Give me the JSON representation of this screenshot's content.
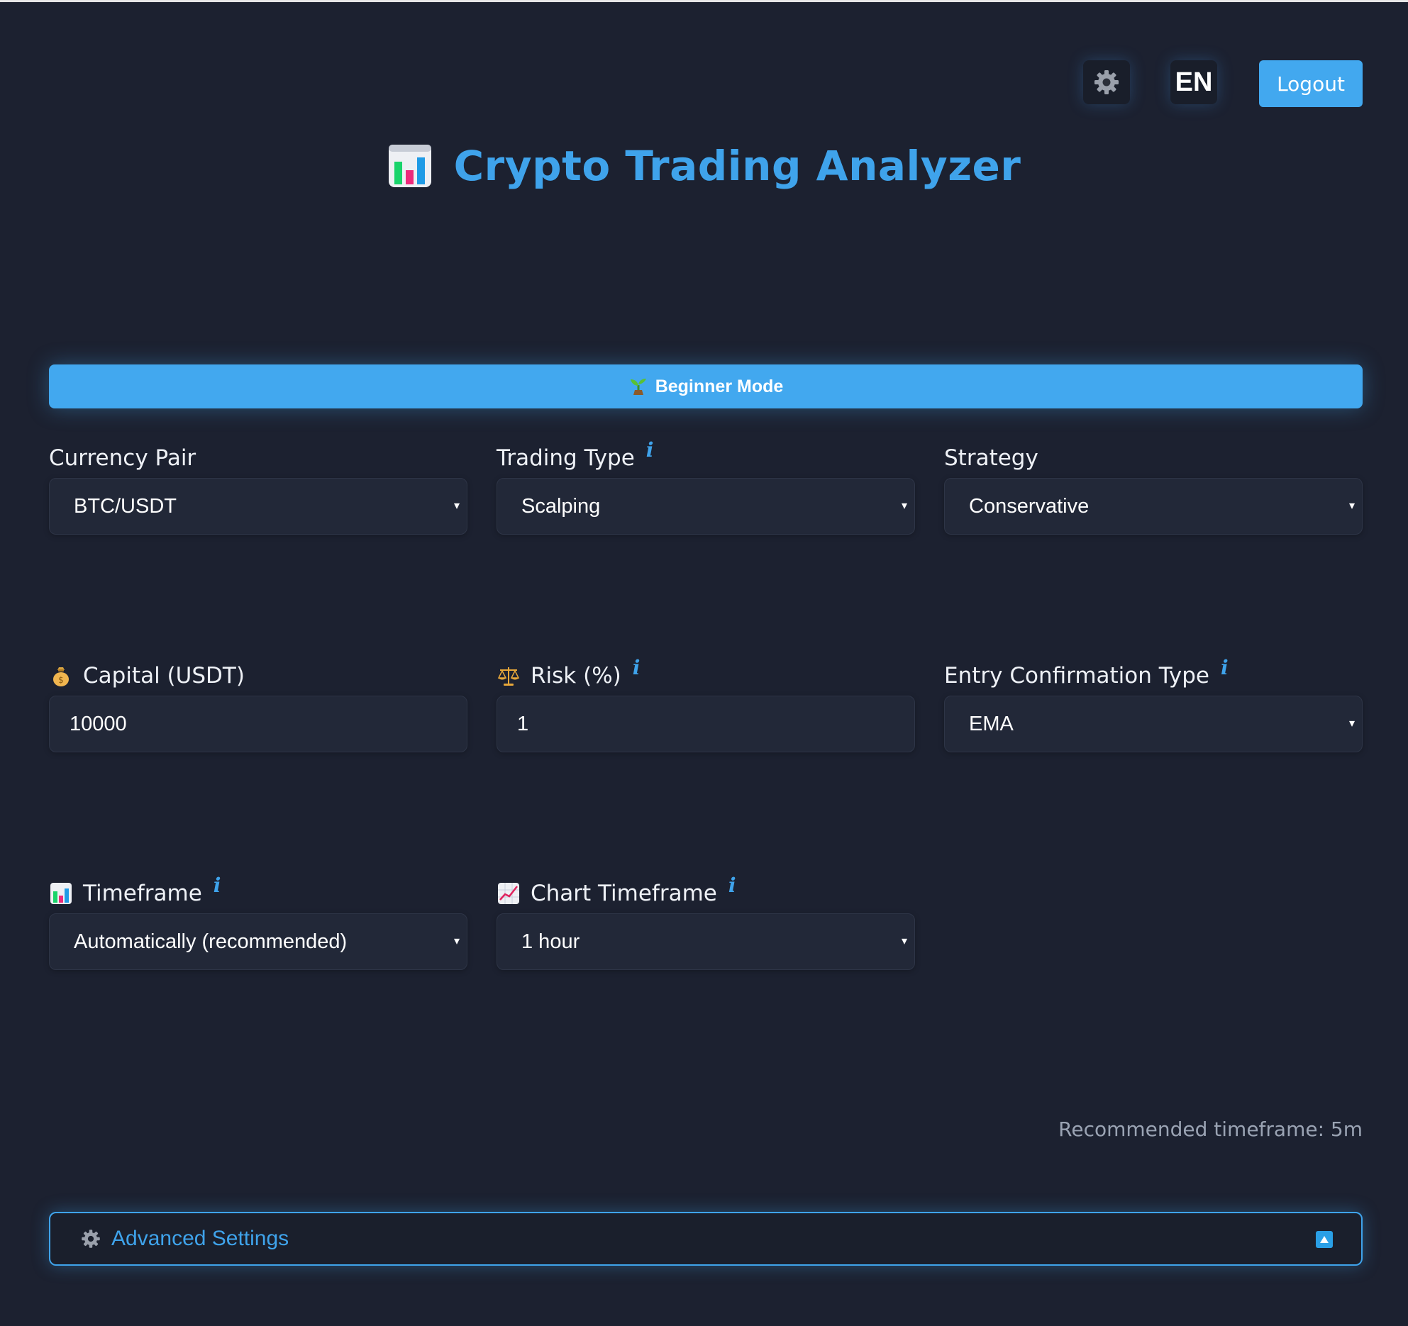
{
  "header": {
    "settings_icon": "gear-icon",
    "language": "EN",
    "logout_label": "Logout"
  },
  "title": {
    "icon": "bar-chart-icon",
    "text": "Crypto Trading Analyzer"
  },
  "mode": {
    "icon": "sprout-icon",
    "label": "Beginner Mode"
  },
  "fields": {
    "currency_pair": {
      "label": "Currency Pair",
      "value": "BTC/USDT"
    },
    "trading_type": {
      "label": "Trading Type",
      "info": "i",
      "value": "Scalping"
    },
    "strategy": {
      "label": "Strategy",
      "value": "Conservative"
    },
    "capital": {
      "icon": "money-bag-icon",
      "label": "Capital (USDT)",
      "value": "10000"
    },
    "risk": {
      "icon": "balance-scale-icon",
      "label": "Risk (%)",
      "info": "i",
      "value": "1"
    },
    "entry_confirmation": {
      "label": "Entry Confirmation Type",
      "info": "i",
      "value": "EMA"
    },
    "timeframe": {
      "icon": "bar-chart-icon",
      "label": "Timeframe",
      "info": "i",
      "value": "Automatically (recommended)"
    },
    "chart_timeframe": {
      "icon": "line-chart-icon",
      "label": "Chart Timeframe",
      "info": "i",
      "value": "1 hour"
    }
  },
  "caret": "▾",
  "recommended": "Recommended timeframe: 5m",
  "advanced": {
    "icon": "gear-icon",
    "label": "Advanced Settings",
    "toggle_icon": "collapse-up-icon"
  },
  "colors": {
    "background": "#1c2130",
    "accent": "#42a8ef",
    "title": "#3fa3eb",
    "control_bg": "#222838"
  }
}
